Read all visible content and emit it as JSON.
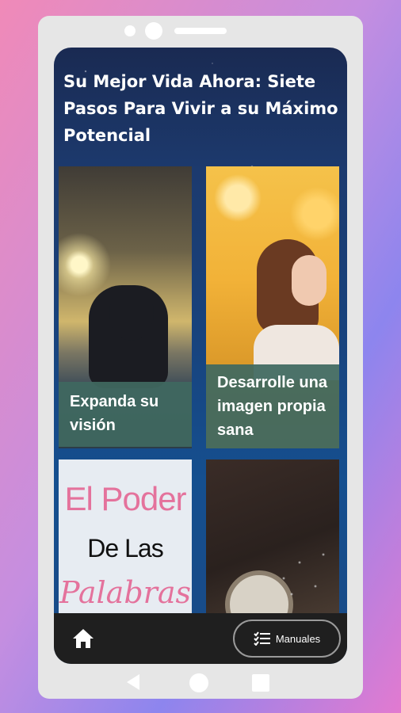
{
  "app": {
    "title": "Su Mejor Vida Ahora: Siete Pasos Para Vivir a su Máximo Potencial"
  },
  "cards": [
    {
      "label": "Expanda su visión",
      "image": "woman-silhouette-sunset"
    },
    {
      "label": "Desarrolle una imagen propia sana",
      "image": "woman-autumn-leaves"
    },
    {
      "label": "",
      "image": "el-poder-de-las-palabras",
      "image_text": [
        "El Poder",
        "De Las",
        "Palabras"
      ]
    },
    {
      "label": "",
      "image": "pocket-watch-dust"
    }
  ],
  "bottom_bar": {
    "home_icon": "home-icon",
    "manuales_label": "Manuales",
    "manuales_icon": "checklist-icon"
  },
  "colors": {
    "caption_bg": "#406860",
    "bottom_bar": "#1f1f1f",
    "accent_pink": "#e4729c"
  }
}
